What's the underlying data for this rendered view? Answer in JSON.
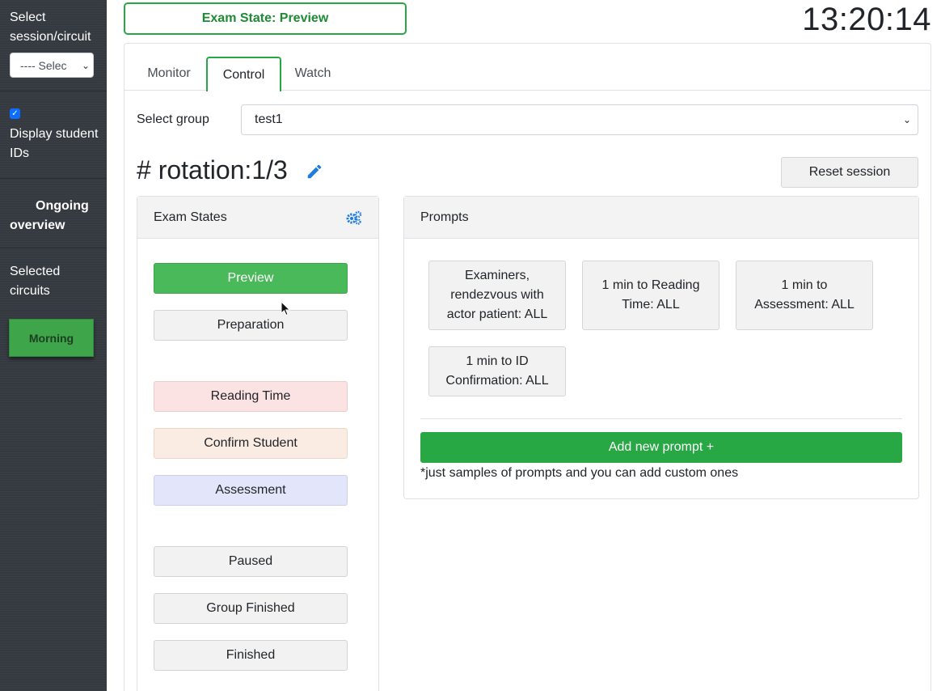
{
  "sidebar": {
    "select_label": "Select session/circuit",
    "select_value": "---- Selec",
    "display_ids_checked": true,
    "display_ids_label": "Display student IDs",
    "ongoing_overview": "Ongoing overview",
    "selected_circuits": "Selected circuits",
    "circuit_button": "Morning"
  },
  "header": {
    "exam_state": "Exam State: Preview",
    "clock": "13:20:14"
  },
  "tabs": [
    {
      "label": "Monitor",
      "active": false
    },
    {
      "label": "Control",
      "active": true
    },
    {
      "label": "Watch",
      "active": false
    }
  ],
  "group": {
    "label": "Select group",
    "value": "test1"
  },
  "rotation_title": "# rotation:1/3",
  "reset_button": "Reset session",
  "exam_states": {
    "header": "Exam States",
    "buttons": [
      "Preview",
      "Preparation",
      "Reading Time",
      "Confirm Student",
      "Assessment",
      "Paused",
      "Group Finished",
      "Finished"
    ]
  },
  "prompts": {
    "header": "Prompts",
    "items": [
      "Examiners, rendezvous with actor patient: ALL",
      "1 min to Reading Time: ALL",
      "1 min to Assessment: ALL",
      "1 min to ID Confirmation: ALL"
    ],
    "add_button": "Add new prompt +",
    "note": "*just samples of prompts and you can add custom ones"
  },
  "colors": {
    "sidebar_bg": "#343a40",
    "accent_green": "#28a745",
    "preview_green": "#4ab95a",
    "reading_pink": "#fbe3e3",
    "confirm_peach": "#fbece3",
    "assessment_lavender": "#e3e6fb"
  }
}
